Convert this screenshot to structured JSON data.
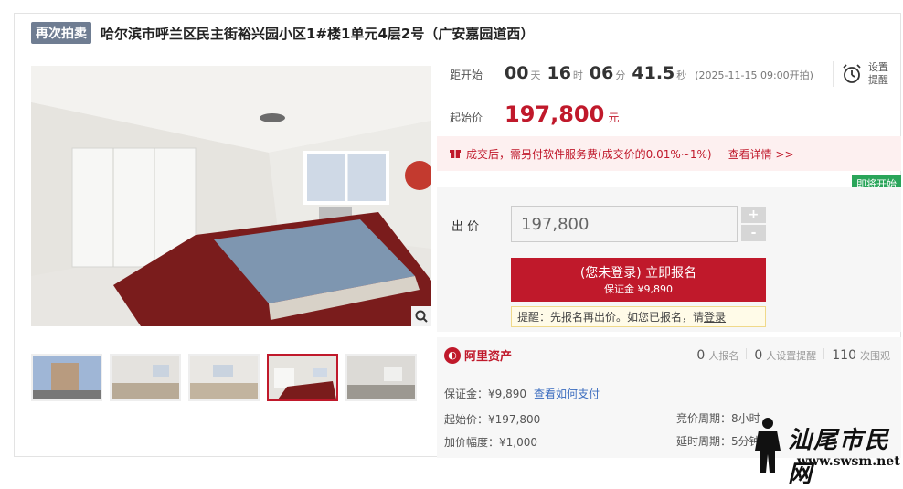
{
  "header": {
    "tag": "再次拍卖",
    "title": "哈尔滨市呼兰区民主街裕兴园小区1#楼1单元4层2号（广安嘉园道西）"
  },
  "countdown": {
    "label": "距开始",
    "days": "00",
    "days_unit": "天",
    "hours": "16",
    "hours_unit": "时",
    "minutes": "06",
    "minutes_unit": "分",
    "seconds": "41.5",
    "seconds_unit": "秒",
    "start_time": "(2025-11-15 09:00开拍)"
  },
  "remind": {
    "label": "设置提醒",
    "icon": "alarm-clock-icon"
  },
  "start_price": {
    "label": "起始价",
    "value": "197,800",
    "unit": "元"
  },
  "fee_notice": {
    "text": "成交后，需另付软件服务费(成交价的0.01%~1%)",
    "link": "查看详情 >>"
  },
  "status": {
    "badge": "即将开始",
    "color": "#2aa55a"
  },
  "bid": {
    "label": "出 价",
    "value": "197,800",
    "plus": "+",
    "minus": "-"
  },
  "signup": {
    "title": "(您未登录) 立即报名",
    "deposit": "保证金 ¥9,890"
  },
  "tip": {
    "text": "提醒：先报名再出价。如您已报名，请",
    "link": "登录"
  },
  "platform": {
    "name": "阿里资产"
  },
  "stats": [
    {
      "num": "0",
      "label": "人报名"
    },
    {
      "num": "0",
      "label": "人设置提醒"
    },
    {
      "num": "110",
      "label": "次围观"
    }
  ],
  "details": {
    "deposit": "保证金：¥9,890",
    "deposit_link": "查看如何支付",
    "start_price": "起始价：¥197,800",
    "increment": "加价幅度：¥1,000",
    "cycle": "竞价周期：8小时",
    "delay": "延时周期：5分钟"
  },
  "watermark": {
    "text": "汕尾市民网",
    "url": "www.swsm.net"
  },
  "colors": {
    "accent": "#c0192b",
    "tag_bg": "#6f7d92",
    "link": "#3b6cbf"
  }
}
